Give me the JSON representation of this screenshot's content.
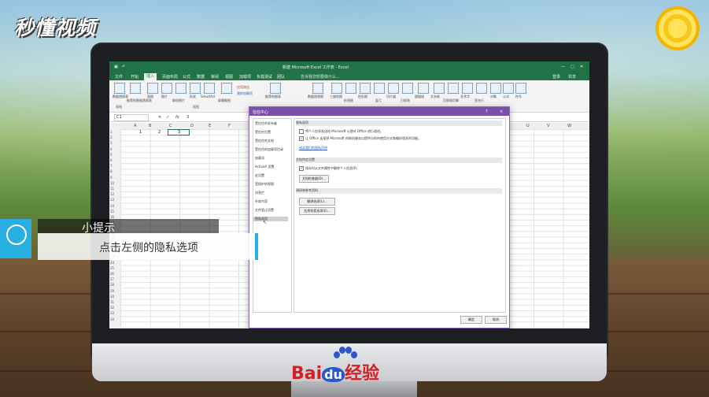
{
  "brand": {
    "top_logo": "秒懂视频",
    "bottom_logo_prefix": "Bai",
    "bottom_logo_du": "du",
    "bottom_logo_suffix": "经验"
  },
  "excel": {
    "window_title": "新建 Microsoft Excel 工作表 - Excel",
    "tell_me": "告诉我您想要做什么...",
    "sign_in": "登录",
    "share": "共享",
    "tabs": [
      "文件",
      "开始",
      "插入",
      "页面布局",
      "公式",
      "数据",
      "审阅",
      "视图",
      "加载项",
      "负载测试",
      "团队"
    ],
    "active_tab": "插入",
    "ribbon_items": [
      "数据透视表",
      "推荐的数据透视表",
      "表格",
      "图片",
      "联机图片",
      "形状",
      "SmartArt",
      "屏幕截图",
      "应用商店",
      "我的加载项",
      "推荐的图表",
      "数据透视图",
      "三维地图",
      "折线图",
      "柱形图",
      "盈亏",
      "切片器",
      "日程表",
      "超链接",
      "文本框",
      "页眉和页脚",
      "艺术字",
      "签名行",
      "对象",
      "公式",
      "符号"
    ],
    "ribbon_groups": [
      "表格",
      "插图"
    ],
    "name_box": "C1",
    "formula_value": "3",
    "columns": [
      "A",
      "B",
      "C",
      "D",
      "E",
      "F",
      "U",
      "V",
      "W"
    ],
    "row_numbers": [
      "1",
      "2",
      "3",
      "4",
      "5",
      "6",
      "7",
      "8",
      "9",
      "10",
      "11",
      "12",
      "13",
      "14",
      "15",
      "16",
      "17",
      "18",
      "19",
      "20",
      "21",
      "22",
      "23",
      "24",
      "25",
      "26",
      "27",
      "28",
      "29",
      "30",
      "31",
      "32",
      "33",
      "34"
    ],
    "cells": [
      {
        "label": "A1",
        "value": "1"
      },
      {
        "label": "B1",
        "value": "2"
      },
      {
        "label": "C1",
        "value": "3"
      }
    ]
  },
  "dialog": {
    "title": "信任中心",
    "help": "?",
    "close": "×",
    "nav": [
      "受信任的发布者",
      "受信任位置",
      "受信任的文档",
      "受信任的加载项目录",
      "加载项",
      "ActiveX 设置",
      "宏设置",
      "受保护的视图",
      "消息栏",
      "外部内容",
      "文件阻止设置",
      "隐私选项"
    ],
    "selected_nav": "隐私选项",
    "section_privacy": "隐私选项",
    "opt1": "将个人信息发送给 Microsoft 以便对 Office 进行改进。",
    "opt1_checked": false,
    "opt2": "让 Office 连接到 Microsoft 的联机服务以提供与你的使用方式和偏好相关的功能。",
    "opt2_checked": true,
    "privacy_link": "阅读我们的隐私声明",
    "section_doc": "文档特定设置",
    "opt3": "保存时从文件属性中删除个人信息(R)",
    "opt3_checked": true,
    "doc_inspector_button": "文档检查器(D)...",
    "section_research": "调研和参考资料",
    "translation_button": "翻译选项(L)...",
    "research_button": "信息检索选项(E)...",
    "ok_button": "确定",
    "cancel_button": "取消"
  },
  "tip": {
    "title": "小提示",
    "body": "点击左侧的隐私选项"
  }
}
